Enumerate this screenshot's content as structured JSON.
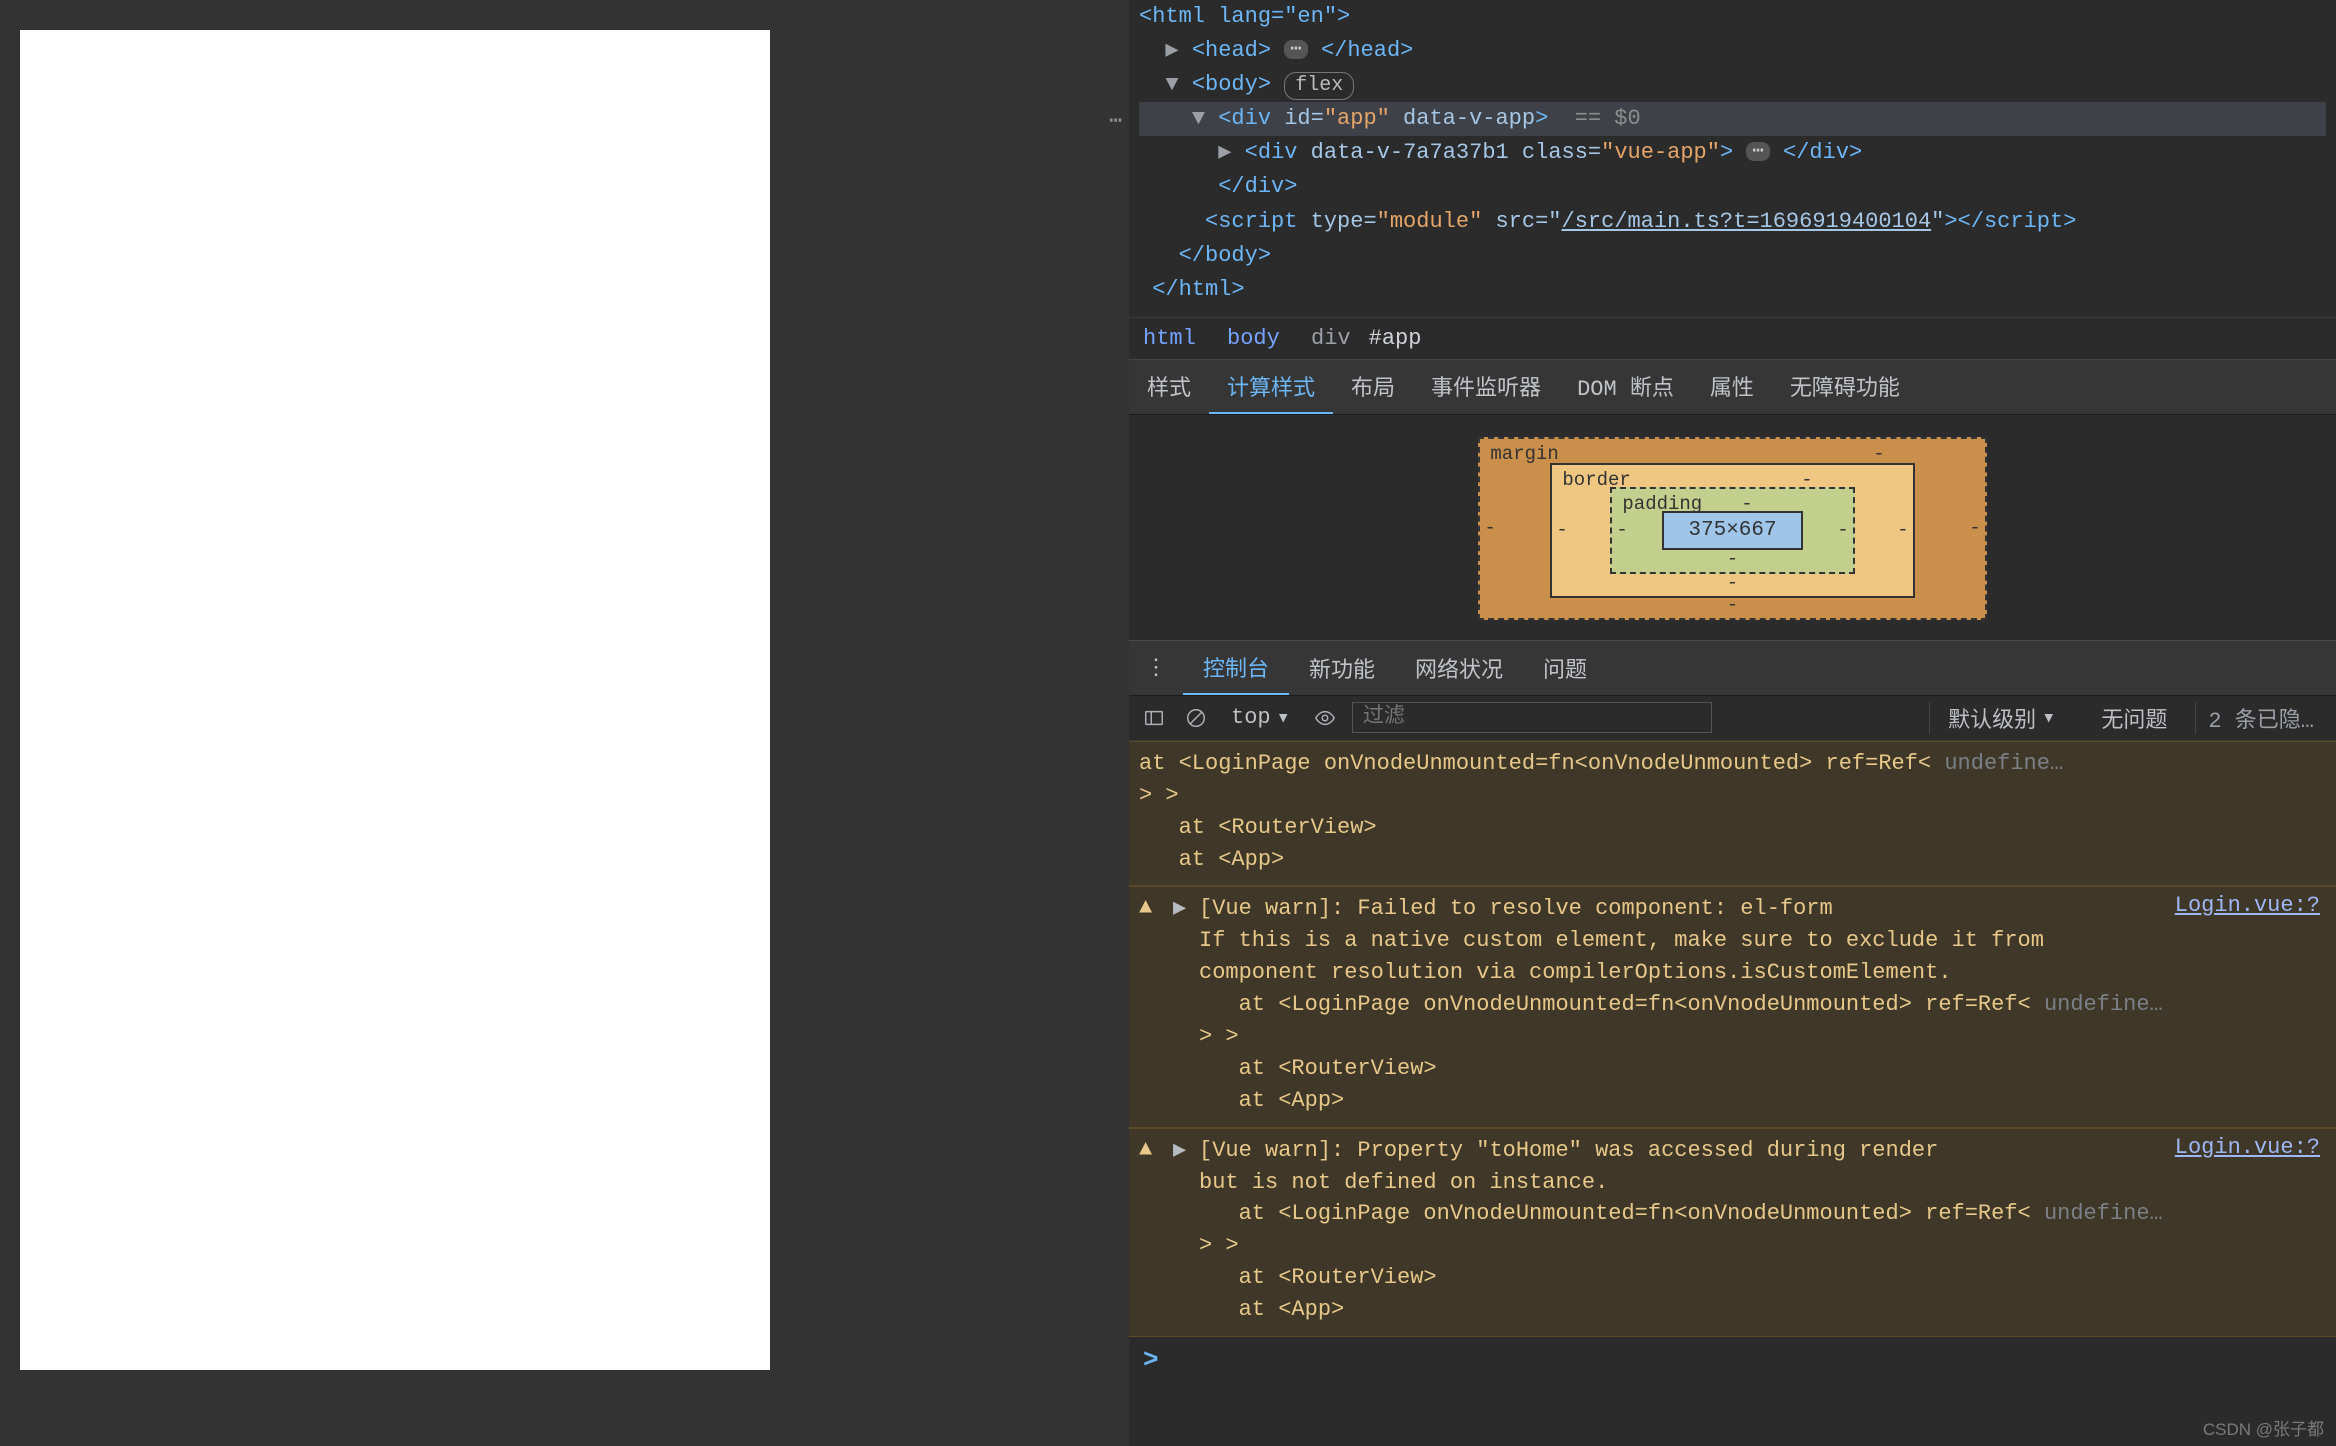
{
  "dom": {
    "l1": "<html lang=\"en\">",
    "head_open": "<head>",
    "head_close": "</head>",
    "body_open": "<body>",
    "body_flex": "flex",
    "div_open": "<div",
    "div_id_attr": " id=",
    "div_id_val": "\"app\"",
    "div_dv": " data-v-app",
    "eq0": "== $0",
    "innerdiv_open": "<div",
    "innerdiv_dv": " data-v-7a7a37b1",
    "innerdiv_classlbl": " class=",
    "innerdiv_classval": "\"vue-app\"",
    "innerdiv_close": "</div>",
    "divend": "</div>",
    "script_open": "<script",
    "script_type_lbl": " type=",
    "script_type_val": "\"module\"",
    "script_src_lbl": " src=",
    "script_src_val": "\"/src/main.ts?t=1696919400104\"",
    "script_close": "></script>",
    "body_close": "</body>",
    "html_close": "</html>"
  },
  "breadcrumb": {
    "a": "html",
    "b": "body",
    "c1": "div",
    "c2": "#app"
  },
  "tabs": {
    "styles": "样式",
    "computed": "计算样式",
    "layout": "布局",
    "listeners": "事件监听器",
    "dombp": "DOM 断点",
    "props": "属性",
    "a11y": "无障碍功能"
  },
  "boxmodel": {
    "margin": "margin",
    "border": "border",
    "padding": "padding",
    "content": "375×667",
    "dash": "-"
  },
  "ctabs": {
    "console": "控制台",
    "new": "新功能",
    "net": "网络状况",
    "issues": "问题"
  },
  "ctoolbar": {
    "ctx": "top",
    "filter_ph": "过滤",
    "level": "默认级别",
    "noissue": "无问题",
    "hidden": "2 条已隐…"
  },
  "messages": {
    "m0": {
      "l1": "at <LoginPage onVnodeUnmounted=fn<onVnodeUnmounted> ref=Ref< ",
      "l1dim": "undefine…",
      "l2": "> >",
      "l3": "   at <RouterView>",
      "l4": "   at <App>"
    },
    "m1": {
      "title": "[Vue warn]: Failed to resolve component: el-form",
      "l2": "If this is a native custom element, make sure to exclude it from",
      "l3": "component resolution via compilerOptions.isCustomElement.",
      "l4": "   at <LoginPage onVnodeUnmounted=fn<onVnodeUnmounted> ref=Ref< ",
      "l4dim": "undefine…",
      "l5": "> >",
      "l6": "   at <RouterView>",
      "l7": "   at <App>",
      "src": "Login.vue:?"
    },
    "m2": {
      "title": "[Vue warn]: Property \"toHome\" was accessed during render",
      "l2": "but is not defined on instance.",
      "l3": "   at <LoginPage onVnodeUnmounted=fn<onVnodeUnmounted> ref=Ref< ",
      "l3dim": "undefine…",
      "l4": "> >",
      "l5": "   at <RouterView>",
      "l6": "   at <App>",
      "src": "Login.vue:?"
    }
  },
  "prompt": ">",
  "watermark": "CSDN @张子都"
}
